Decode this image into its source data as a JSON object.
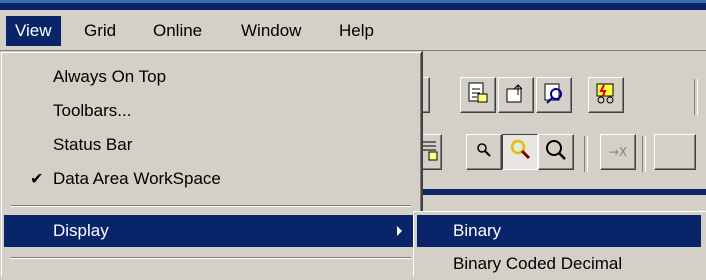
{
  "menubar": {
    "items": [
      {
        "label": "View",
        "active": true
      },
      {
        "label": "Grid"
      },
      {
        "label": "Online"
      },
      {
        "label": "Window"
      },
      {
        "label": "Help"
      }
    ]
  },
  "view_menu": {
    "items": [
      {
        "label": "Always On Top",
        "checked": false
      },
      {
        "label": "Toolbars...",
        "checked": false
      },
      {
        "label": "Status Bar",
        "checked": false
      },
      {
        "label": "Data Area WorkSpace",
        "checked": true
      },
      {
        "label": "Display",
        "has_submenu": true,
        "highlighted": true
      }
    ],
    "check_glyph": "✔"
  },
  "display_submenu": {
    "items": [
      {
        "label": "Binary",
        "highlighted": true
      },
      {
        "label": "Binary Coded Decimal"
      }
    ]
  },
  "colors": {
    "menu_highlight": "#0a246a",
    "face": "#d4d0c8"
  },
  "toolbar_icons": [
    "binary-view-icon",
    "upload-icon",
    "find-icon",
    "online-connect-icon",
    "zoom-icon",
    "zoom-highlight-icon",
    "zoom-fit-icon",
    "close-x-icon"
  ]
}
